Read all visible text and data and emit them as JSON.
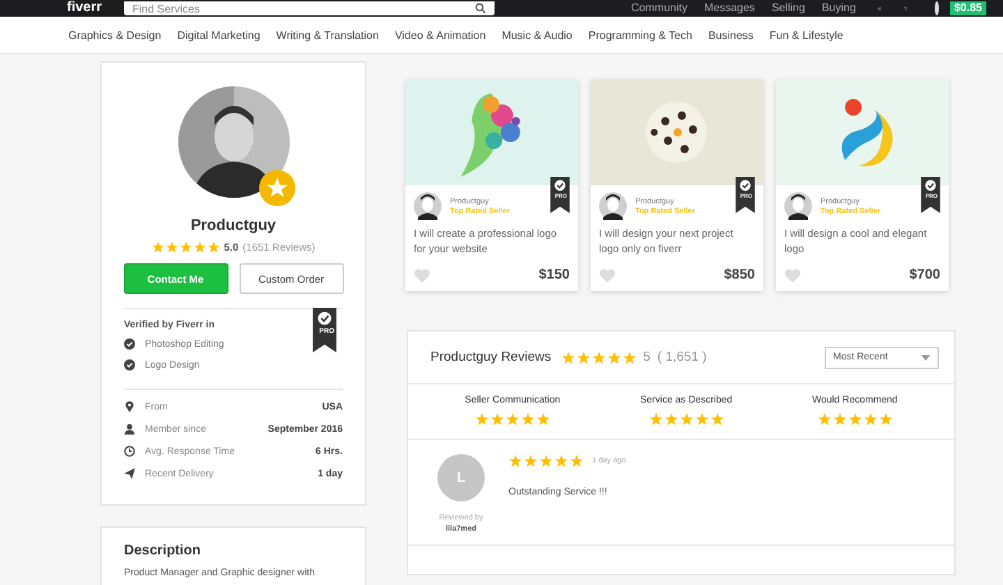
{
  "top_bar": {
    "logo": "fiverr",
    "search": {
      "placeholder": "Find Services"
    },
    "links": [
      "Community",
      "Messages",
      "Selling",
      "Buying"
    ],
    "balance": "$0.85"
  },
  "categories": [
    "Graphics & Design",
    "Digital Marketing",
    "Writing & Translation",
    "Video & Animation",
    "Music & Audio",
    "Programming & Tech",
    "Business",
    "Fun & Lifestyle"
  ],
  "profile": {
    "name": "Productguy",
    "stars": 5,
    "rating": "5.0",
    "reviews_count": "(1651 Reviews)",
    "buttons": [
      "Contact Me",
      "Custom Order"
    ],
    "verified": {
      "title": "Verified by Fiverr in",
      "badge": "PRO",
      "skills": [
        "Photoshop Editing",
        "Logo Design"
      ]
    },
    "details": [
      {
        "kind": "location",
        "label": "From",
        "value": "USA"
      },
      {
        "kind": "member",
        "label": "Member since",
        "value": "September 2016"
      },
      {
        "kind": "clock",
        "label": "Avg. Response Time",
        "value": "6 Hrs."
      },
      {
        "kind": "delivery",
        "label": "Recent Delivery",
        "value": "1 day"
      }
    ]
  },
  "description": {
    "title": "Description",
    "text": "Product Manager and Graphic designer with"
  },
  "gigs": [
    {
      "seller": "Productguy",
      "level": "Top Rated Seller",
      "badge": "PRO",
      "title": "I will create a professional logo for your website",
      "price": "$150"
    },
    {
      "seller": "Productguy",
      "level": "Top Rated Seller",
      "badge": "PRO",
      "title": "I will design your next project logo only on fiverr",
      "price": "$850"
    },
    {
      "seller": "Productguy",
      "level": "Top Rated Seller",
      "badge": "PRO",
      "title": "I will design a cool and elegant logo",
      "price": "$700"
    }
  ],
  "reviews": {
    "title": "Productguy Reviews",
    "stars": 5,
    "score": "5",
    "count": "( 1,651 )",
    "sort": "Most Recent",
    "criteria": [
      {
        "label": "Seller Communication",
        "stars": 5
      },
      {
        "label": "Service as Described",
        "stars": 5
      },
      {
        "label": "Would Recommend",
        "stars": 5
      }
    ],
    "items": [
      {
        "initial": "L",
        "stars": 5,
        "time": "1 day ago.",
        "text": "Outstanding Service !!!",
        "reviewed_by": "Reviewed by",
        "reviewer": "lila7med"
      }
    ]
  }
}
